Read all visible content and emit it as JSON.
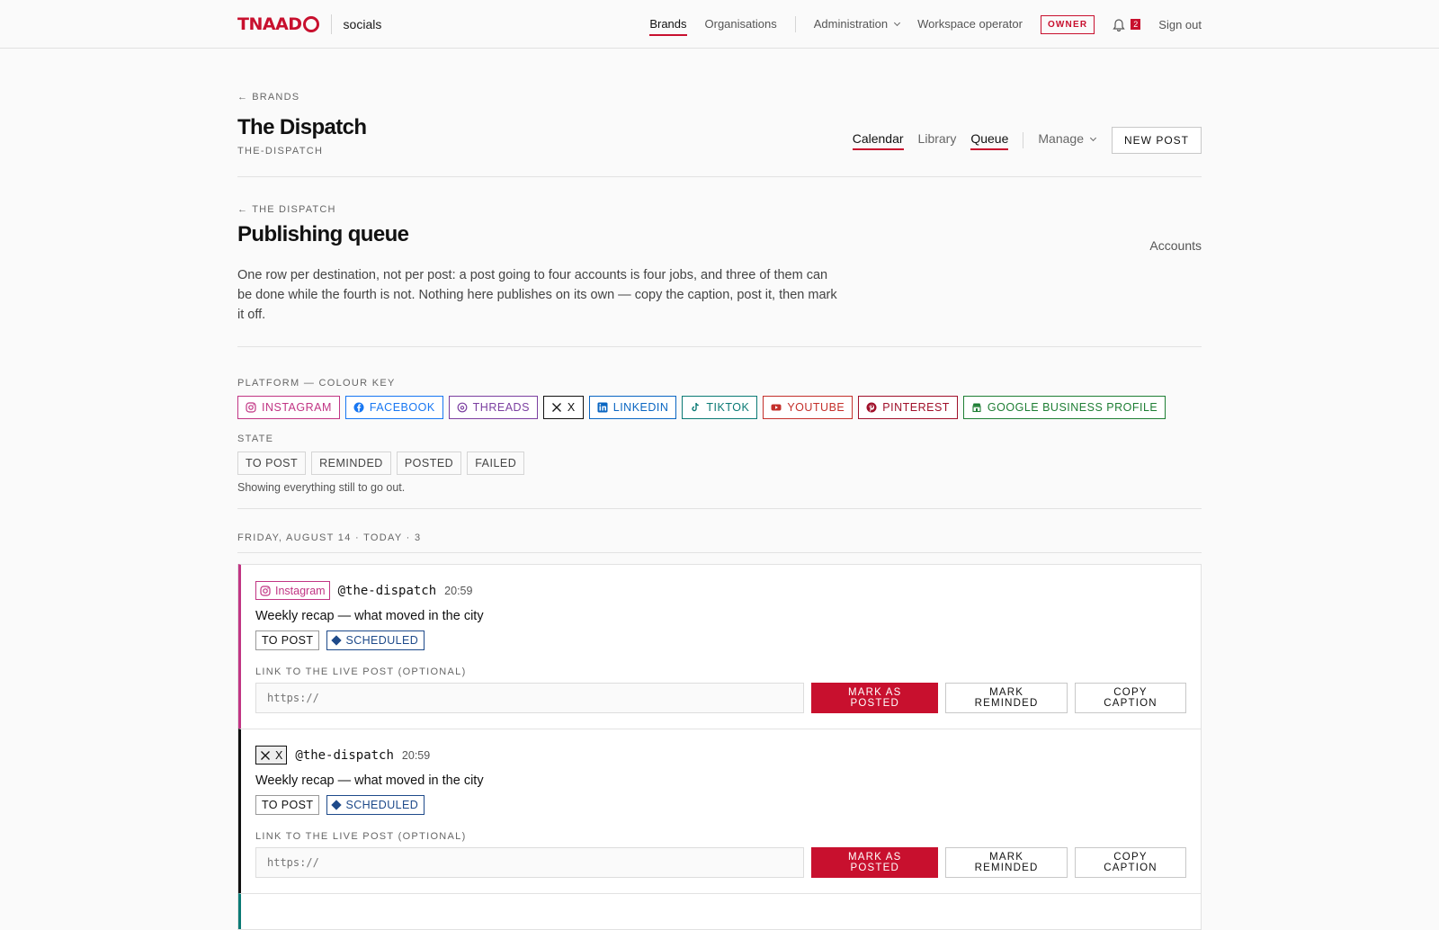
{
  "topbar": {
    "logo_text": "TNAAD",
    "app_name": "socials",
    "nav": [
      {
        "label": "Brands",
        "active": true
      },
      {
        "label": "Organisations",
        "active": false
      }
    ],
    "administration": "Administration",
    "operator": "Workspace operator",
    "role_badge": "OWNER",
    "notification_count": "2",
    "sign_out": "Sign out"
  },
  "brand": {
    "back_label": "BRANDS",
    "name": "The Dispatch",
    "slug": "THE-DISPATCH",
    "tabs": [
      {
        "label": "Calendar",
        "active": true
      },
      {
        "label": "Library",
        "active": false
      },
      {
        "label": "Queue",
        "active": true
      }
    ],
    "manage": "Manage",
    "new_post": "NEW POST"
  },
  "queue": {
    "back_label": "THE DISPATCH",
    "title": "Publishing queue",
    "accounts_link": "Accounts",
    "description": "One row per destination, not per post: a post going to four accounts is four jobs, and three of them can be done while the fourth is not. Nothing here publishes on its own — copy the caption, post it, then mark it off."
  },
  "platform_key": {
    "label": "PLATFORM — COLOUR KEY",
    "items": [
      {
        "label": "INSTAGRAM",
        "color": "#c13584",
        "icon": "instagram-icon"
      },
      {
        "label": "FACEBOOK",
        "color": "#1877f2",
        "icon": "facebook-icon"
      },
      {
        "label": "THREADS",
        "color": "#7b3fa0",
        "icon": "threads-icon"
      },
      {
        "label": "X",
        "color": "#111111",
        "icon": "x-icon"
      },
      {
        "label": "LINKEDIN",
        "color": "#0a66c2",
        "icon": "linkedin-icon"
      },
      {
        "label": "TIKTOK",
        "color": "#0b7a75",
        "icon": "tiktok-icon"
      },
      {
        "label": "YOUTUBE",
        "color": "#c4302b",
        "icon": "youtube-icon"
      },
      {
        "label": "PINTEREST",
        "color": "#a0102a",
        "icon": "pinterest-icon"
      },
      {
        "label": "GOOGLE BUSINESS PROFILE",
        "color": "#1e7e34",
        "icon": "google-business-icon"
      }
    ]
  },
  "state_filter": {
    "label": "STATE",
    "items": [
      "TO POST",
      "REMINDED",
      "POSTED",
      "FAILED"
    ],
    "hint": "Showing everything still to go out."
  },
  "day": {
    "heading": "FRIDAY, AUGUST 14 · TODAY · 3",
    "rows": [
      {
        "platform": "Instagram",
        "platform_color": "#c13584",
        "platform_icon": "instagram-icon",
        "handle": "@the-dispatch",
        "time": "20:59",
        "title": "Weekly recap — what moved in the city",
        "state": "TO POST",
        "schedule": "SCHEDULED",
        "link_label": "LINK TO THE LIVE POST (OPTIONAL)",
        "link_placeholder": "https://",
        "mark_posted": "MARK AS POSTED",
        "mark_reminded": "MARK REMINDED",
        "copy_caption": "COPY CAPTION"
      },
      {
        "platform": "X",
        "platform_color": "#111111",
        "platform_icon": "x-icon",
        "handle": "@the-dispatch",
        "time": "20:59",
        "title": "Weekly recap — what moved in the city",
        "state": "TO POST",
        "schedule": "SCHEDULED",
        "link_label": "LINK TO THE LIVE POST (OPTIONAL)",
        "link_placeholder": "https://",
        "mark_posted": "MARK AS POSTED",
        "mark_reminded": "MARK REMINDED",
        "copy_caption": "COPY CAPTION"
      }
    ],
    "next_row_color": "#0b7a75"
  },
  "colors": {
    "accent": "#c8102e",
    "scheduled": "#1e4a8a"
  }
}
